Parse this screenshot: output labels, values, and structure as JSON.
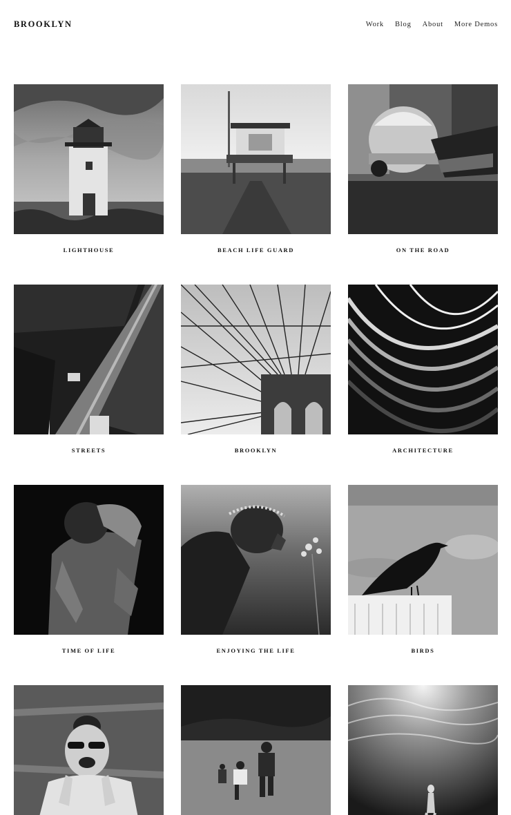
{
  "brand": {
    "logo": "BROOKLYN"
  },
  "nav": {
    "items": [
      "Work",
      "Blog",
      "About",
      "More Demos"
    ]
  },
  "portfolio": {
    "items": [
      {
        "title": "LIGHTHOUSE",
        "image": "lighthouse-photo"
      },
      {
        "title": "BEACH LIFE GUARD",
        "image": "lifeguard-tower-photo"
      },
      {
        "title": "ON THE ROAD",
        "image": "vintage-car-photo"
      },
      {
        "title": "STREETS",
        "image": "city-street-aerial-photo"
      },
      {
        "title": "BROOKLYN",
        "image": "brooklyn-bridge-photo"
      },
      {
        "title": "ARCHITECTURE",
        "image": "architecture-waves-photo"
      },
      {
        "title": "TIME OF LIFE",
        "image": "man-portrait-photo"
      },
      {
        "title": "ENJOYING THE LIFE",
        "image": "girl-with-flowers-photo"
      },
      {
        "title": "BIRDS",
        "image": "crow-photo"
      },
      {
        "title": "",
        "image": "laughing-woman-photo"
      },
      {
        "title": "",
        "image": "kids-running-photo"
      },
      {
        "title": "",
        "image": "underwater-diver-photo"
      }
    ]
  }
}
